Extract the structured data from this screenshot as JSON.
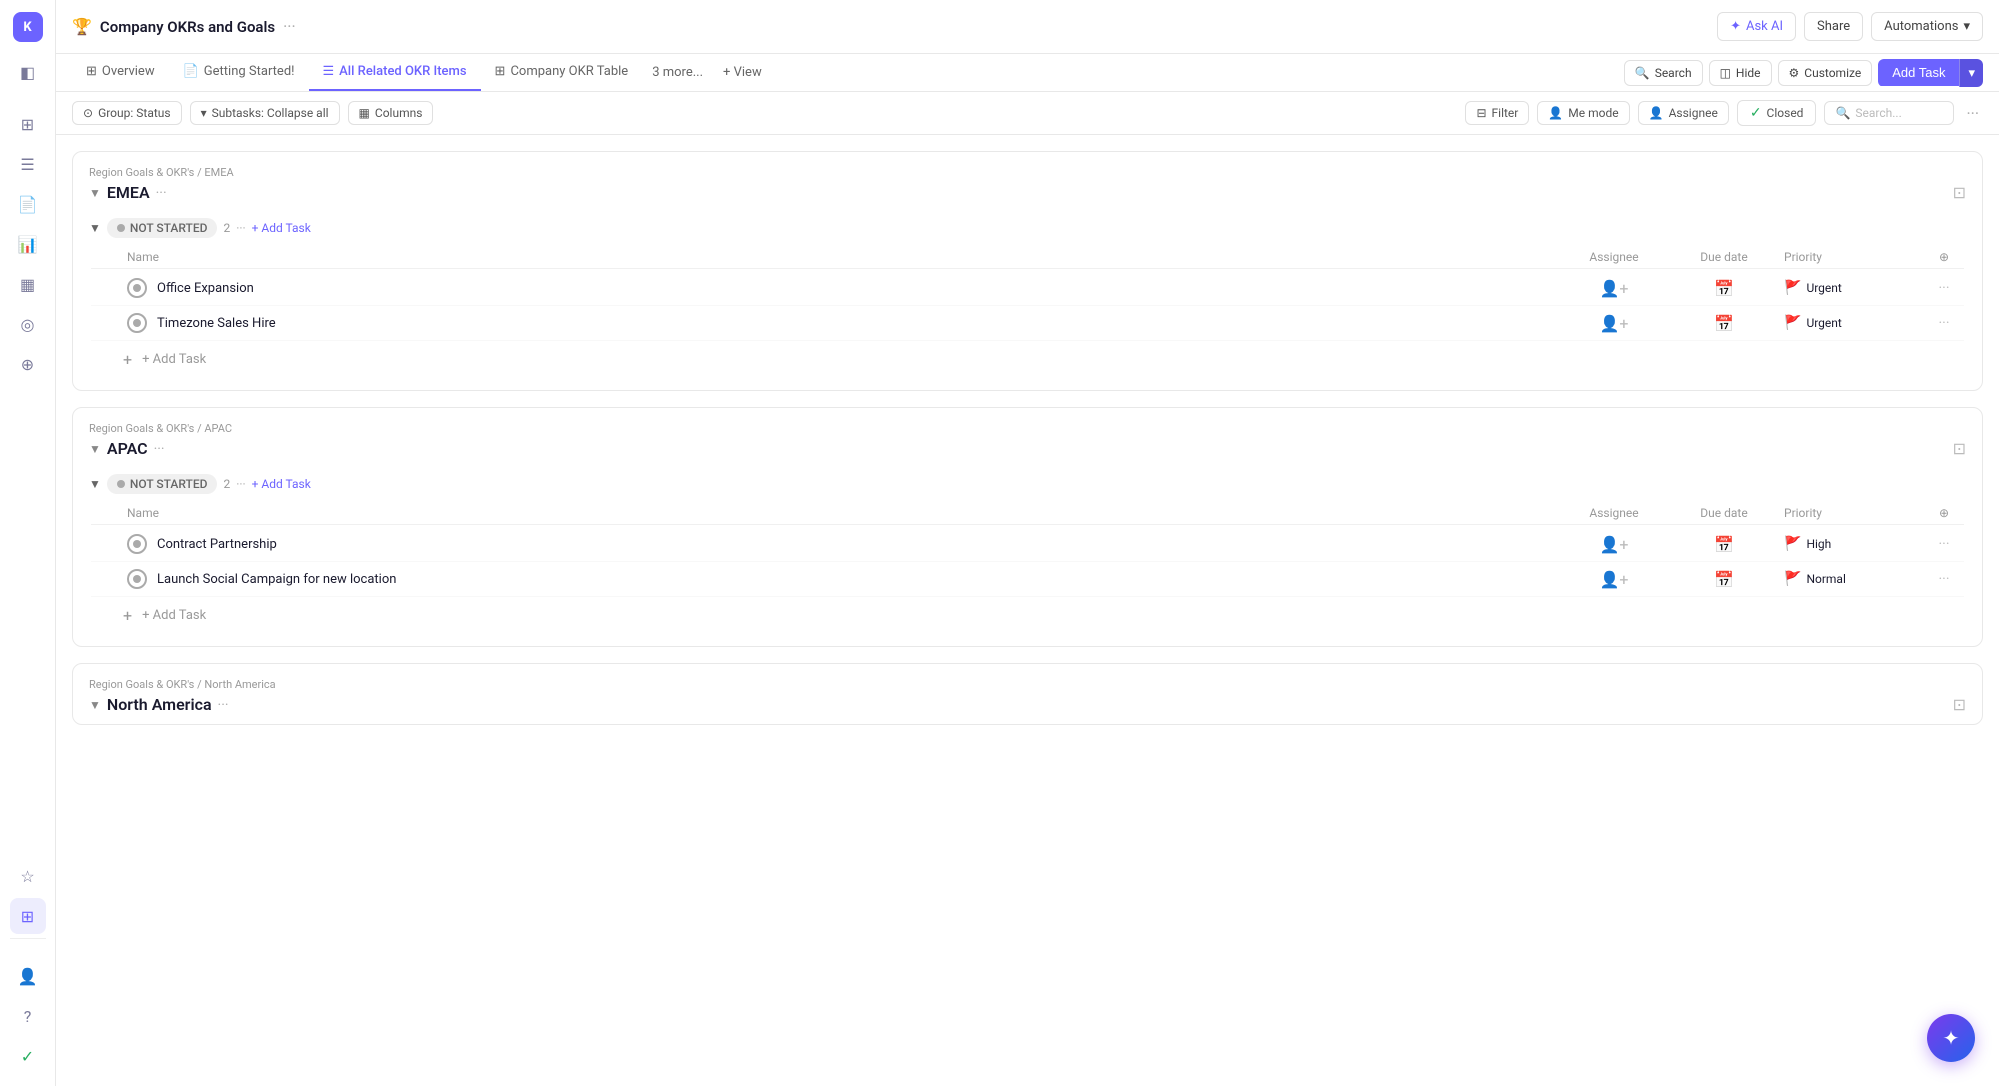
{
  "sidebar": {
    "avatar": "K",
    "icons": [
      {
        "name": "home-icon",
        "symbol": "⊞",
        "active": false
      },
      {
        "name": "inbox-icon",
        "symbol": "☰",
        "active": false
      },
      {
        "name": "document-icon",
        "symbol": "📄",
        "active": false
      },
      {
        "name": "chart-icon",
        "symbol": "📊",
        "active": false
      },
      {
        "name": "grid-icon",
        "symbol": "▦",
        "active": false
      },
      {
        "name": "target-icon",
        "symbol": "◎",
        "active": false
      },
      {
        "name": "add-icon",
        "symbol": "+",
        "active": false
      }
    ],
    "bottom_icons": [
      {
        "name": "star-icon",
        "symbol": "☆",
        "active": false
      },
      {
        "name": "apps-icon",
        "symbol": "⊞",
        "active": true
      },
      {
        "name": "people-icon",
        "symbol": "👤",
        "active": false
      },
      {
        "name": "help-icon",
        "symbol": "?",
        "active": false
      }
    ],
    "status_icon": {
      "symbol": "✓",
      "active": false
    }
  },
  "header": {
    "collapse_icon": "▪",
    "page_icon": "🏆",
    "title": "Company OKRs and Goals",
    "more": "···",
    "ask_ai_label": "Ask AI",
    "share_label": "Share",
    "automations_label": "Automations",
    "automations_caret": "▾"
  },
  "tabs": [
    {
      "label": "Overview",
      "icon": "⊞",
      "active": false
    },
    {
      "label": "Getting Started!",
      "icon": "📄",
      "active": false
    },
    {
      "label": "All Related OKR Items",
      "icon": "☰",
      "active": true
    },
    {
      "label": "Company OKR Table",
      "icon": "⊞",
      "active": false
    }
  ],
  "tabs_more": "3 more...",
  "tabs_add_view": "+ View",
  "toolbar": {
    "group_label": "Group: Status",
    "group_icon": "⊙",
    "subtasks_label": "Subtasks: Collapse all",
    "subtasks_icon": "▾",
    "columns_label": "Columns",
    "columns_icon": "▦",
    "filter_label": "Filter",
    "memode_label": "Me mode",
    "assignee_label": "Assignee",
    "closed_label": "Closed",
    "search_placeholder": "Search...",
    "more": "···"
  },
  "sections": [
    {
      "id": "emea",
      "breadcrumb": "Region Goals & OKR's / EMEA",
      "title": "EMEA",
      "status_groups": [
        {
          "status": "NOT STARTED",
          "count": 2,
          "tasks": [
            {
              "name": "Office Expansion",
              "priority": "Urgent",
              "priority_type": "urgent"
            },
            {
              "name": "Timezone Sales Hire",
              "priority": "Urgent",
              "priority_type": "urgent"
            }
          ]
        }
      ]
    },
    {
      "id": "apac",
      "breadcrumb": "Region Goals & OKR's / APAC",
      "title": "APAC",
      "status_groups": [
        {
          "status": "NOT STARTED",
          "count": 2,
          "tasks": [
            {
              "name": "Contract Partnership",
              "priority": "High",
              "priority_type": "high"
            },
            {
              "name": "Launch Social Campaign for new location",
              "priority": "Normal",
              "priority_type": "normal"
            }
          ]
        }
      ]
    },
    {
      "id": "north-america",
      "breadcrumb": "Region Goals & OKR's / North America",
      "title": "North America",
      "status_groups": []
    }
  ],
  "table_headers": {
    "name": "Name",
    "assignee": "Assignee",
    "due_date": "Due date",
    "priority": "Priority"
  },
  "add_task_label": "+ Add Task",
  "fab_icon": "✦"
}
